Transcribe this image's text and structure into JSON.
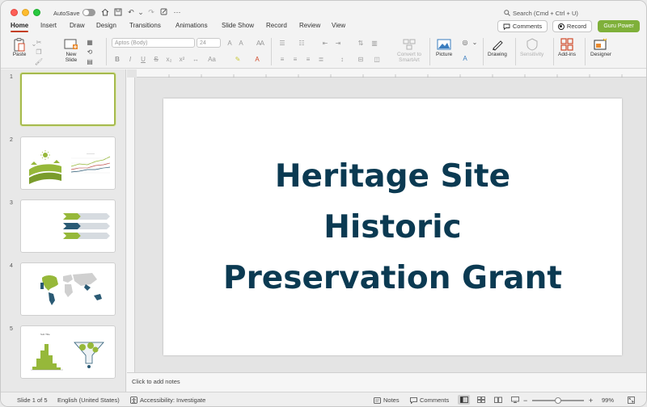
{
  "titlebar": {
    "autosave_label": "AutoSave",
    "search_placeholder": "Search (Cmd + Ctrl + U)"
  },
  "tabs": [
    "Home",
    "Insert",
    "Draw",
    "Design",
    "Transitions",
    "Animations",
    "Slide Show",
    "Record",
    "Review",
    "View"
  ],
  "topbuttons": {
    "comments": "Comments",
    "record": "Record",
    "guru": "Guru Power"
  },
  "ribbon": {
    "paste": "Paste",
    "new_slide": [
      "New",
      "Slide"
    ],
    "font_name": "Aptos (Body)",
    "font_size": "24",
    "convert_smartart": [
      "Convert to",
      "SmartArt"
    ],
    "picture": "Picture",
    "drawing": "Drawing",
    "sensitivity": "Sensitivity",
    "addins": "Add-ins",
    "designer": "Designer"
  },
  "slides": [
    {
      "number": "1"
    },
    {
      "number": "2"
    },
    {
      "number": "3"
    },
    {
      "number": "4"
    },
    {
      "number": "5"
    }
  ],
  "thumb5": {
    "title": "Sub Title"
  },
  "slide": {
    "title_lines": [
      "Heritage Site",
      "Historic",
      "Preservation Grant"
    ]
  },
  "notes_placeholder": "Click to add notes",
  "status": {
    "slide_of": "Slide 1 of 5",
    "language": "English (United States)",
    "accessibility": "Accessibility: Investigate",
    "notes": "Notes",
    "comments": "Comments",
    "zoom": "99%"
  },
  "colors": {
    "accent_tab": "#c43e1c",
    "title_text": "#0b3a52",
    "guru_button": "#7fb03a",
    "thumb_green": "#96b83a",
    "thumb_navy": "#2a5a74"
  }
}
